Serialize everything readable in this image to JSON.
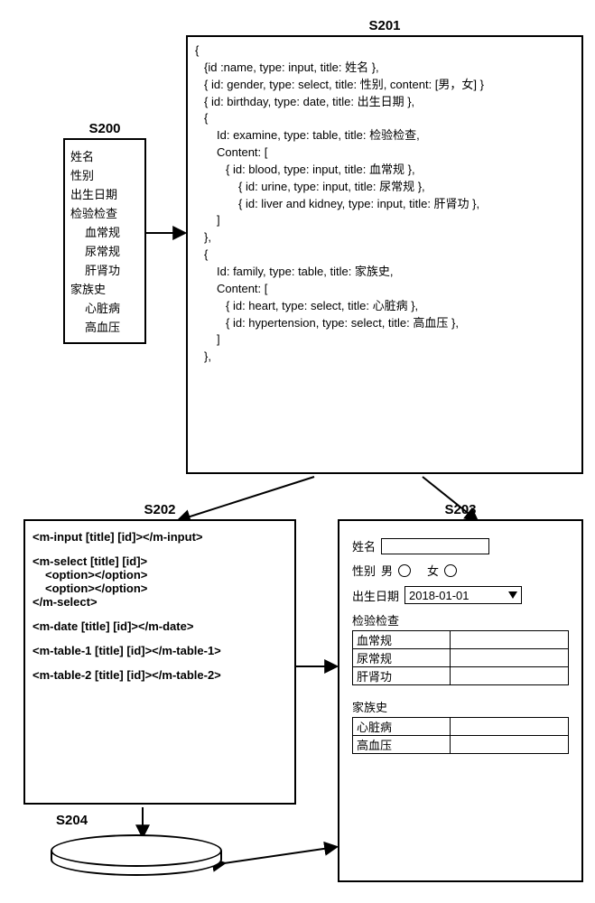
{
  "labels": {
    "s200": "S200",
    "s201": "S201",
    "s202": "S202",
    "s203": "S203",
    "s204": "S204"
  },
  "s200": {
    "items": [
      {
        "text": "姓名"
      },
      {
        "text": "性别"
      },
      {
        "text": "出生日期"
      },
      {
        "text": "检验检查"
      },
      {
        "text": "血常规",
        "indent": 1
      },
      {
        "text": "尿常规",
        "indent": 1
      },
      {
        "text": "肝肾功",
        "indent": 1
      },
      {
        "text": "家族史"
      },
      {
        "text": "心脏病",
        "indent": 1
      },
      {
        "text": "高血压",
        "indent": 1
      }
    ]
  },
  "s201": {
    "lines": [
      {
        "t": "{",
        "cls": ""
      },
      {
        "t": "{id :name, type: input, title: 姓名 },",
        "cls": "indent-a"
      },
      {
        "t": "{ id: gender, type: select, title: 性别, content: [男，女] }",
        "cls": "indent-a"
      },
      {
        "t": "{ id: birthday, type: date, title: 出生日期 },",
        "cls": "indent-a"
      },
      {
        "t": "{",
        "cls": "indent-a"
      },
      {
        "t": "Id: examine, type: table, title: 检验检查,",
        "cls": "indent-b"
      },
      {
        "t": "Content: [",
        "cls": "indent-b"
      },
      {
        "t": "{ id: blood, type: input, title: 血常规 },",
        "cls": "indent-c"
      },
      {
        "t": "{ id: urine, type: input, title: 尿常规 },",
        "cls": "indent-d"
      },
      {
        "t": "{ id: liver and kidney, type: input, title: 肝肾功 },",
        "cls": "indent-d"
      },
      {
        "t": "]",
        "cls": "indent-b"
      },
      {
        "t": "},",
        "cls": "indent-a"
      },
      {
        "t": "{",
        "cls": "indent-a"
      },
      {
        "t": "Id: family, type: table, title: 家族史,",
        "cls": "indent-b"
      },
      {
        "t": "Content: [",
        "cls": "indent-b"
      },
      {
        "t": "{ id: heart, type: select, title: 心脏病 },",
        "cls": "indent-c"
      },
      {
        "t": "{ id: hypertension, type: select, title: 高血压 },",
        "cls": "indent-c"
      },
      {
        "t": "]",
        "cls": "indent-b"
      },
      {
        "t": "},",
        "cls": "indent-a"
      }
    ]
  },
  "s202": {
    "lines": [
      {
        "t": "<m-input [title] [id]></m-input>",
        "cls": ""
      },
      {
        "t": "",
        "gap": true
      },
      {
        "t": "<m-select [title] [id]>",
        "cls": ""
      },
      {
        "t": "<option></option>",
        "cls": "child"
      },
      {
        "t": "<option></option>",
        "cls": "child"
      },
      {
        "t": "</m-select>",
        "cls": ""
      },
      {
        "t": "",
        "gap": true
      },
      {
        "t": "<m-date [title] [id]></m-date>",
        "cls": ""
      },
      {
        "t": "",
        "gap": true
      },
      {
        "t": "<m-table-1 [title] [id]></m-table-1>",
        "cls": ""
      },
      {
        "t": "",
        "gap": true
      },
      {
        "t": "<m-table-2 [title] [id]></m-table-2>",
        "cls": ""
      }
    ]
  },
  "s203": {
    "name_label": "姓名",
    "gender_label": "性别",
    "gender_options": {
      "m": "男",
      "f": "女"
    },
    "birthday_label": "出生日期",
    "birthday_value": "2018-01-01",
    "examine_title": "检验检查",
    "examine_rows": [
      "血常规",
      "尿常规",
      "肝肾功"
    ],
    "family_title": "家族史",
    "family_rows": [
      "心脏病",
      "高血压"
    ]
  }
}
